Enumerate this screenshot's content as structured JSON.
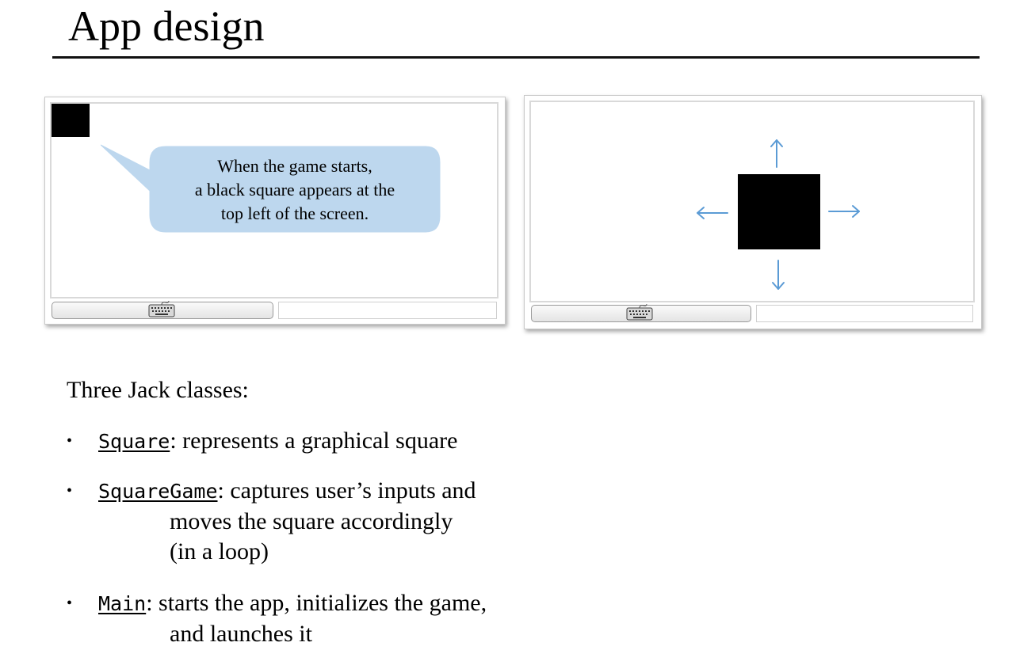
{
  "title": "App design",
  "panels": {
    "left": {
      "callout": {
        "line1": "When the game starts,",
        "line2": "a black square appears at the",
        "line3": "top left of the screen."
      }
    },
    "right": {
      "arrows": [
        "up",
        "down",
        "left",
        "right"
      ]
    }
  },
  "icons": {
    "keyboard": "keyboard-icon",
    "arrow_up": "arrow-up-icon",
    "arrow_down": "arrow-down-icon",
    "arrow_left": "arrow-left-icon",
    "arrow_right": "arrow-right-icon"
  },
  "colors": {
    "callout_fill": "#bdd7ee",
    "arrow": "#5b9bd5",
    "square": "#000000"
  },
  "intro": "Three Jack classes:",
  "bullets": [
    {
      "code": "Square",
      "text": ": represents a graphical square",
      "cont": []
    },
    {
      "code": "SquareGame",
      "text": ": captures user’s inputs and",
      "cont": [
        "moves the square accordingly",
        "(in a loop)"
      ]
    },
    {
      "code": "Main",
      "text": ": starts the app, initializes the game,",
      "cont": [
        "and launches it"
      ]
    }
  ]
}
